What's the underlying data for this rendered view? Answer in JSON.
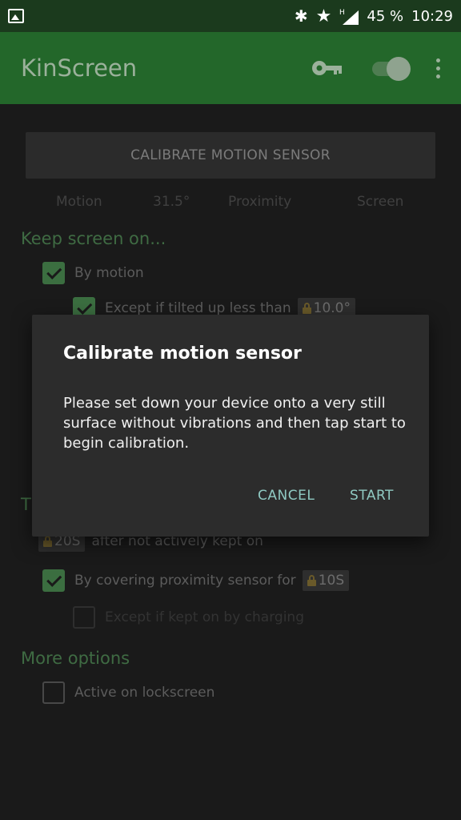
{
  "status_bar": {
    "battery": "45 %",
    "time": "10:29",
    "network_type": "H"
  },
  "app_bar": {
    "title": "KinScreen"
  },
  "calibrate_button": "CALIBRATE MOTION SENSOR",
  "readouts": {
    "motion_label": "Motion",
    "angle": "31.5°",
    "proximity_label": "Proximity",
    "screen_label": "Screen"
  },
  "keep_screen_on": {
    "heading": "Keep screen on...",
    "by_motion": {
      "label": "By motion",
      "checked": true
    },
    "except_tilted": {
      "label": "Except if tilted up less than",
      "value": "10.0°",
      "checked": true
    }
  },
  "turn_off": {
    "heading_partial": "T",
    "timeout": {
      "value": "20S",
      "suffix": "after not actively kept on"
    },
    "by_covering": {
      "label": "By covering proximity sensor for",
      "value": "10S",
      "checked": true
    },
    "except_charging": {
      "label": "Except if kept on by charging",
      "checked": false
    }
  },
  "more_options": {
    "heading": "More options",
    "lockscreen": {
      "label": "Active on lockscreen",
      "checked": false
    }
  },
  "dialog": {
    "title": "Calibrate motion sensor",
    "message": "Please set down your device onto a very still surface without vibrations and then tap start to begin calibration.",
    "cancel": "CANCEL",
    "start": "START"
  }
}
